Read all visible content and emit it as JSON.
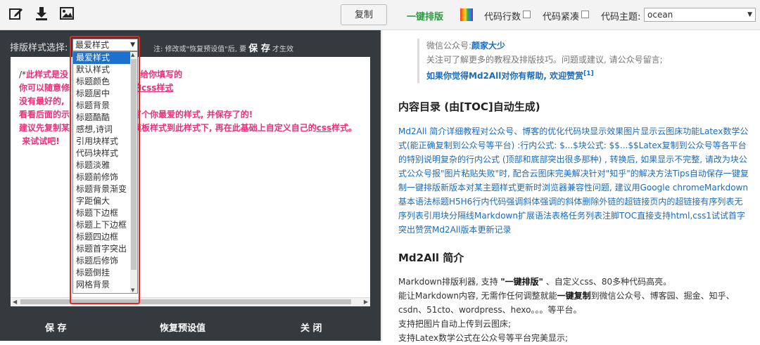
{
  "toolbar": {
    "copy_label": "复制",
    "one_key_label": "一键排版",
    "line_numbers_label": "代码行数",
    "compact_label": "代码紧凑",
    "theme_label": "代码主题:",
    "theme_value": "ocean",
    "icons": [
      "edit-icon",
      "download-icon",
      "image-icon",
      "palette-icon"
    ]
  },
  "style_panel": {
    "style_label": "排版样式选择:",
    "selected_style": "最爱样式",
    "note_prefix": "注: 修改或\"恢复预设值\"后, 要",
    "note_save": "保 存",
    "note_suffix": "才生效",
    "options": [
      "最爱样式",
      "默认样式",
      "标题颜色",
      "标题居中",
      "标题背景",
      "标题酷酷",
      "感想,诗词",
      "引用块样式",
      "代码块样式",
      "标题淡雅",
      "标题前修饰",
      "标题背景渐变",
      "字距偏大",
      "标题下边框",
      "标题上下边框",
      "标题四边框",
      "标题首字突出",
      "标题后修饰",
      "标题倒挂",
      "网格背景"
    ],
    "editor_lines": {
      "l1_a": "/*",
      "l1_b": "此样式是没",
      "l1_c": "给你填写的",
      "l2_a": "你可以随意修",
      "l2_b": "的css样式",
      "l3": "没有最好的,",
      "l4_a": "看看后面的示",
      "l4_b": "写个你最爱的样式, 并保存了的!",
      "l5_a": "建议先复制某",
      "l5_b": "模板样式到此样式下, 再在此基础上自定义自己的",
      "l5_c": "css",
      "l5_d": "样式。",
      "l6": "来试试吧!"
    },
    "save_btn": "保 存",
    "restore_btn": "恢复预设值",
    "close_btn": "关 闭"
  },
  "preview": {
    "wechat_label": "微信公众号:",
    "author": "颜家大少",
    "follow_text": "关注可了解更多的教程及排版技巧。问题或建议, 请公众号留言;",
    "help_text": "如果你觉得Md2All对你有帮助, 欢迎赞赏",
    "help_sup": "[1]",
    "toc_title": "内容目录 (由[TOC]自动生成)",
    "toc_text": "Md2All 简介详细教程对公众号、博客的优化代码块显示效果图片显示云图床功能Latex数学公式(能正确复制到公众号等平台) :行内公式: $...$块公式: $$...$$Latex复制到公众号等各平台的特别说明复杂的行内公式 (顶部和底部突出很多那种) , 转换后, 如果显示不完整, 请改为块公式公众号报\"图片粘贴失败\"时, 配合云图床完美解决针对\"知乎\"的解决方法Tips自动保存一键复制一键排版新版本对某主题样式更新时浏览器兼容性问题, 建议用Google chromeMarkdown基本语法标题H5H6行内代码强调斜体强调的斜体删除外链的超链接页内的超链接有序列表无序列表引用块分隔线Markdown扩展语法表格任务列表注脚TOC直接支持html,css1试试首字突出赞赏Md2All版本更新记录",
    "intro_title": "Md2All 简介",
    "p1_a": "Markdown排版利器, 支持 ",
    "p1_b": "\"一键排版\"",
    "p1_c": " 、自定义css、80多种代码高亮。",
    "p2_a": "能让Markdown内容, 无需作任何调整就能",
    "p2_b": "一键复制",
    "p2_c": "到微信公众号、博客园、掘金、知乎、csdn、51cto、wordpress、hexo。。。等平台。",
    "p3": "支持把图片自动上传到云图床;",
    "p4": "支持Latex数学公式在公众号等平台完美显示;"
  }
}
